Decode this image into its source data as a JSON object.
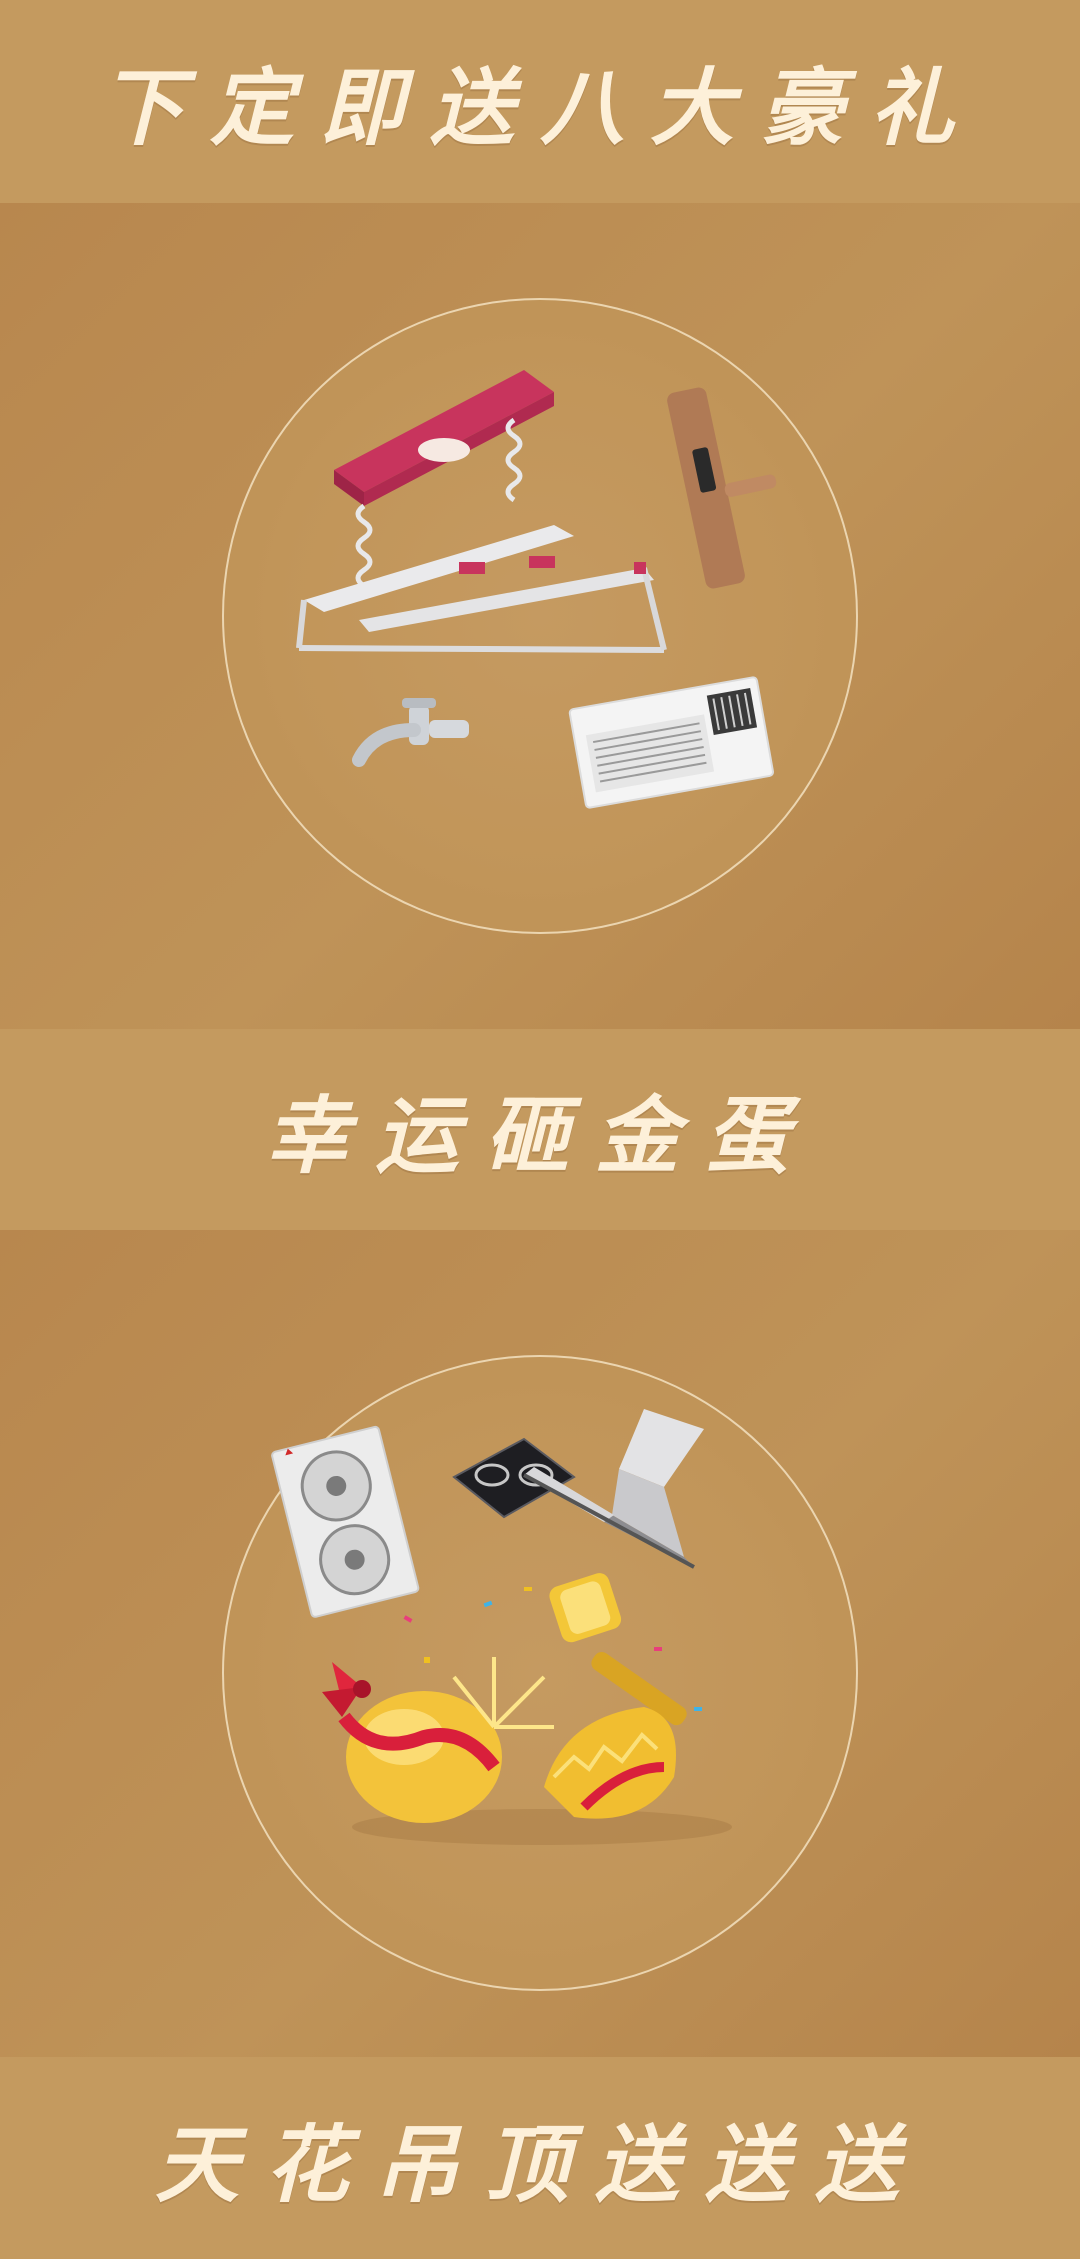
{
  "banners": {
    "top": "下定即送八大豪礼",
    "middle": "幸运砸金蛋",
    "bottom": "天花吊顶送送送"
  },
  "icons": {
    "gift_set_1": [
      "clothes-drying-rack-icon",
      "smart-door-lock-icon",
      "faucet-icon",
      "bathroom-heater-icon"
    ],
    "gift_set_2": [
      "air-conditioner-outdoor-unit-icon",
      "gas-stove-icon",
      "range-hood-icon",
      "golden-hammer-icon",
      "golden-egg-icon"
    ]
  },
  "colors": {
    "banner_bg": "#c49a5f",
    "panel_bg": "#b98951",
    "title_text": "#fdf0d9",
    "circle_stroke": "#faebcd"
  }
}
